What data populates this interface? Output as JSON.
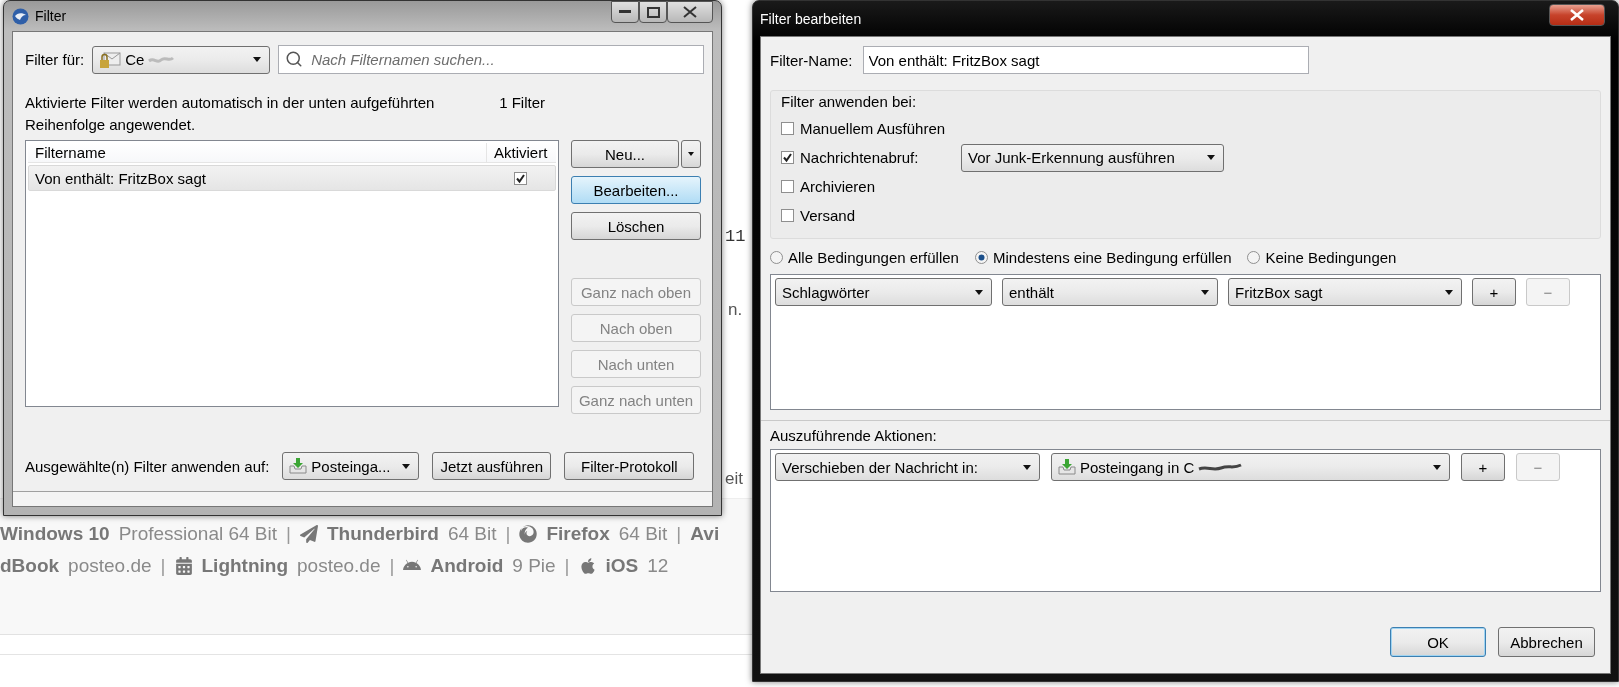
{
  "background_page": {
    "fragments": [
      {
        "text": "11",
        "kind": "mono"
      },
      {
        "text": "n.",
        "kind": "plain"
      },
      {
        "text": "eit",
        "kind": "plain"
      }
    ],
    "lines": [
      [
        {
          "kind": "item",
          "name": "Windows 10",
          "detail": "Professional 64 Bit"
        },
        {
          "kind": "separator",
          "text": "|"
        },
        {
          "kind": "item",
          "name": "Thunderbird",
          "detail": "64 Bit"
        },
        {
          "kind": "separator",
          "text": "|"
        },
        {
          "kind": "item",
          "name": "Firefox",
          "detail": "64 Bit"
        },
        {
          "kind": "separator",
          "text": "|"
        },
        {
          "kind": "item",
          "name": "Avi"
        }
      ],
      [
        {
          "kind": "item",
          "name": "dBook",
          "detail": "posteo.de"
        },
        {
          "kind": "separator",
          "text": "|"
        },
        {
          "kind": "item",
          "name": "Lightning",
          "detail": "posteo.de"
        },
        {
          "kind": "separator",
          "text": "|"
        },
        {
          "kind": "item",
          "name": "Android",
          "detail": "9 Pie"
        },
        {
          "kind": "separator",
          "text": "|"
        },
        {
          "kind": "item",
          "name": "iOS",
          "detail": "12"
        }
      ]
    ]
  },
  "filter_window": {
    "title": "Filter",
    "filter_for": {
      "label": "Filter für:",
      "account": "Ce"
    },
    "search": {
      "placeholder": "Nach Filternamen suchen..."
    },
    "description": "Aktivierte Filter werden automatisch in der unten aufgeführten Reihenfolge angewendet.",
    "count": "1 Filter",
    "list": {
      "columns": [
        "Filtername",
        "Aktiviert"
      ],
      "rows": [
        {
          "name": "Von enthält: FritzBox sagt",
          "enabled": true,
          "selected": true
        }
      ]
    },
    "buttons": [
      {
        "label": "Neu...",
        "kind": "split",
        "disabled": false,
        "focused": false
      },
      {
        "label": "Bearbeiten...",
        "kind": "plain",
        "disabled": false,
        "focused": true
      },
      {
        "label": "Löschen",
        "kind": "plain",
        "disabled": false,
        "focused": false
      },
      {
        "label": "Ganz nach oben",
        "kind": "plain",
        "disabled": true,
        "focused": false
      },
      {
        "label": "Nach oben",
        "kind": "plain",
        "disabled": true,
        "focused": false
      },
      {
        "label": "Nach unten",
        "kind": "plain",
        "disabled": true,
        "focused": false
      },
      {
        "label": "Ganz nach unten",
        "kind": "plain",
        "disabled": true,
        "focused": false
      }
    ],
    "apply": {
      "label": "Ausgewählte(n) Filter anwenden auf:",
      "folder": "Posteinga...",
      "run": "Jetzt ausführen",
      "log": "Filter-Protokoll"
    }
  },
  "edit_window": {
    "title": "Filter bearbeiten",
    "name_label": "Filter-Name:",
    "name_value": "Von enthält: FritzBox sagt",
    "apply_group": {
      "legend": "Filter anwenden bei:",
      "options": [
        {
          "label": "Manuellem Ausführen",
          "checked": false
        },
        {
          "label": "Nachrichtenabruf:",
          "checked": true,
          "dropdown": "Vor Junk-Erkennung ausführen"
        },
        {
          "label": "Archivieren",
          "checked": false
        },
        {
          "label": "Versand",
          "checked": false
        }
      ]
    },
    "match": [
      {
        "label": "Alle Bedingungen erfüllen",
        "selected": false
      },
      {
        "label": "Mindestens eine Bedingung erfüllen",
        "selected": true
      },
      {
        "label": "Keine Bedingungen",
        "selected": false
      }
    ],
    "conditions": [
      {
        "field": "Schlagwörter",
        "operator": "enthält",
        "value": "FritzBox sagt",
        "add": "+",
        "remove": "−",
        "remove_disabled": true
      }
    ],
    "actions_label": "Auszuführende Aktionen:",
    "actions": [
      {
        "action": "Verschieben der Nachricht in:",
        "target": "Posteingang in C",
        "add": "+",
        "remove": "−",
        "remove_disabled": true
      }
    ],
    "buttons": [
      {
        "label": "OK",
        "default": true
      },
      {
        "label": "Abbrechen",
        "default": false
      }
    ]
  }
}
